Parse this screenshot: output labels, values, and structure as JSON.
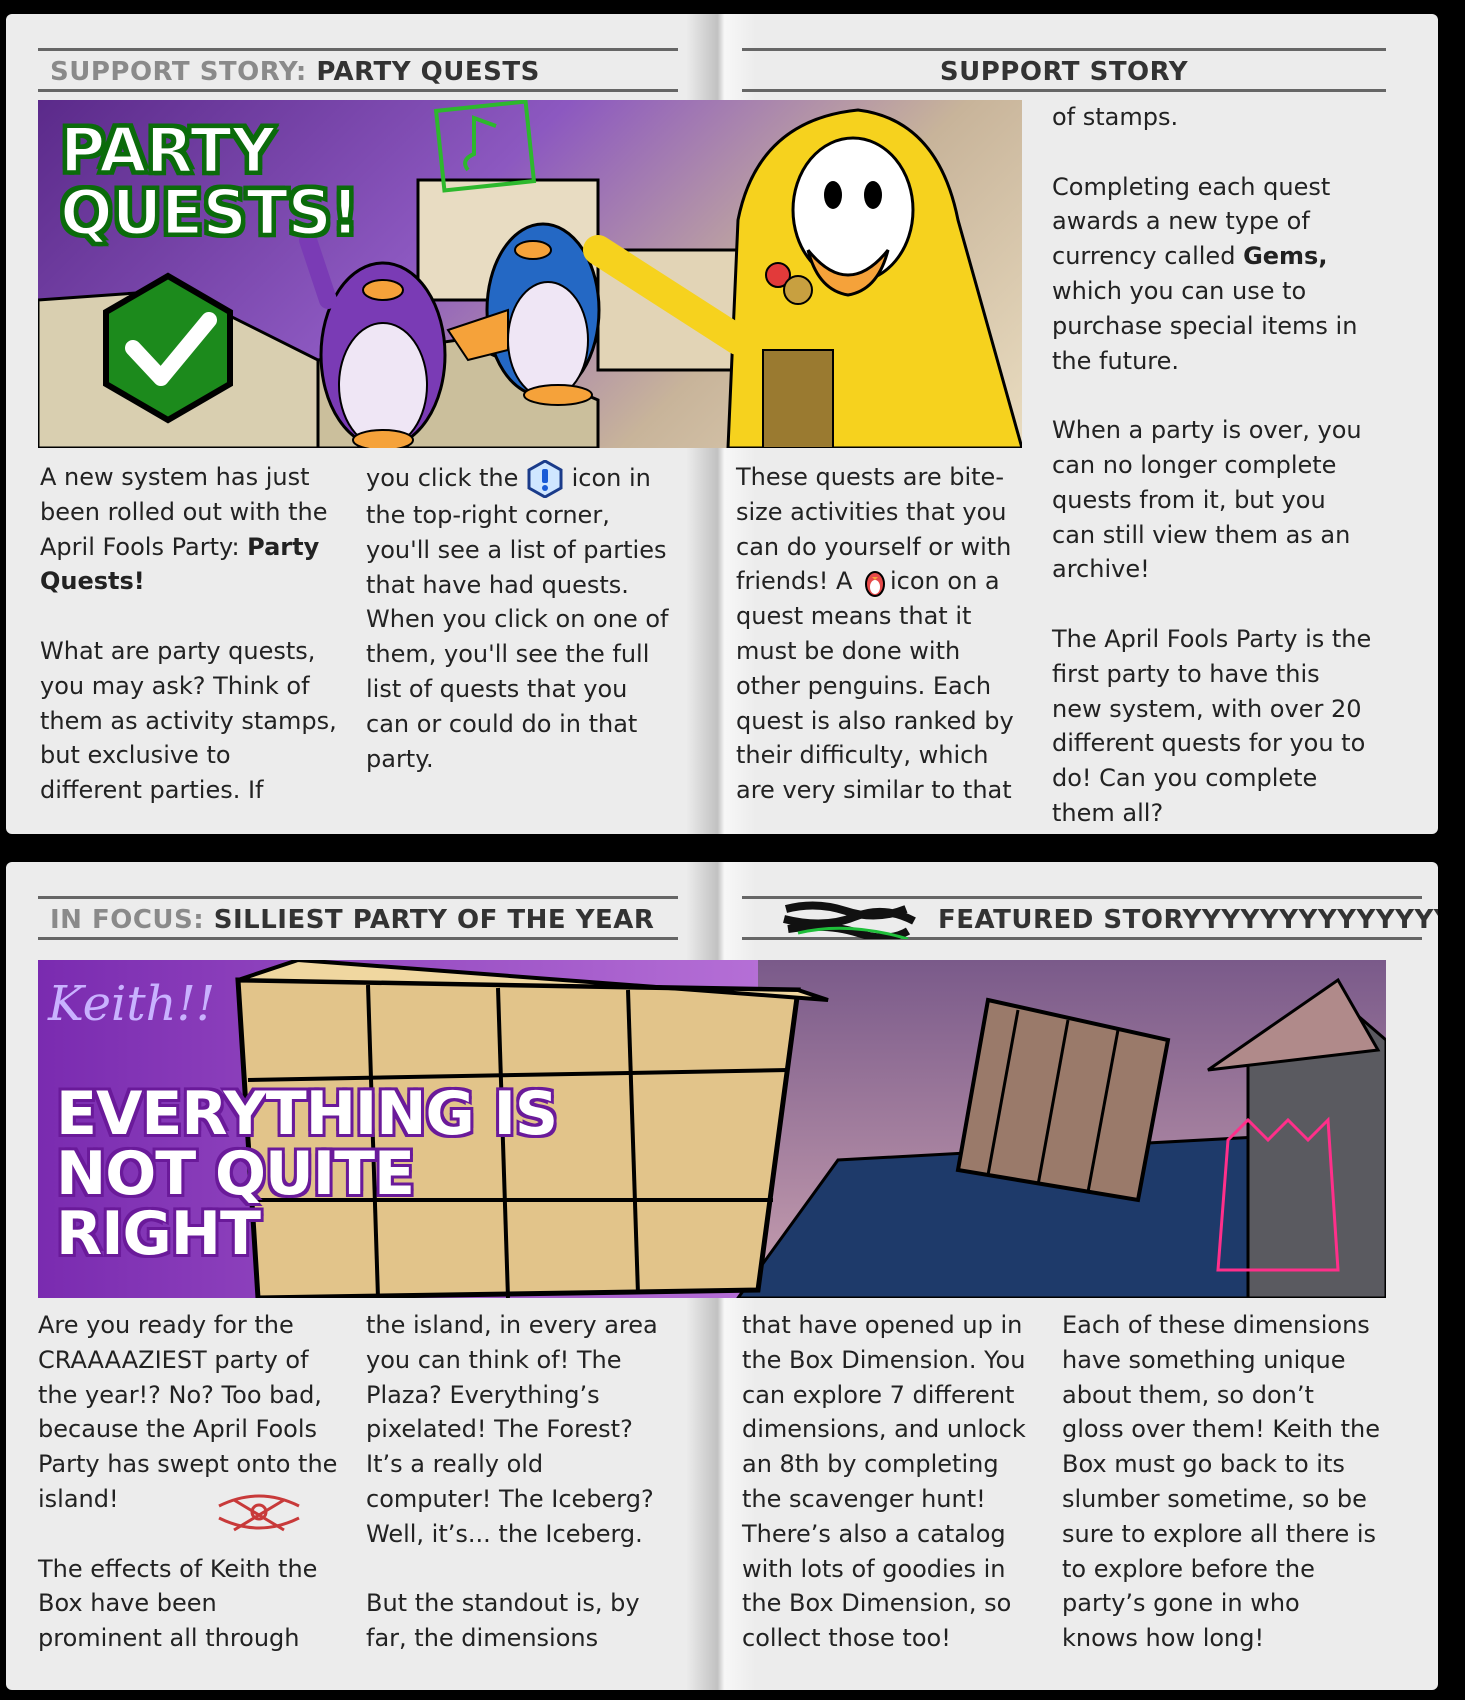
{
  "top_left_header": {
    "lead": "SUPPORT STORY:",
    "title": "PARTY QUESTS"
  },
  "top_right_header": {
    "title": "SUPPORT STORY"
  },
  "top_banner_title": "PARTY QUESTS!",
  "top_col1": {
    "p1_a": "A new system has just been rolled out with the April Fools Party: ",
    "p1_b": "Party Quests!",
    "p2": "What are party quests, you may ask? Think of them as activity stamps, but exclusive to different parties. If"
  },
  "top_col2": {
    "p1_a": "you click the ",
    "p1_b": " icon in the top-right corner, you'll see a list of parties that have had quests. When you click on one of them, you'll see the full list of quests that you can or could do in that party."
  },
  "top_col3": {
    "p1_a": "These quests are bite-size activities that you can do yourself or with friends! A ",
    "p1_b": "icon on a quest means that it must be done with other penguins. Each quest is also ranked by their difficulty, which are very similar to that"
  },
  "top_col4": {
    "p1": "of stamps.",
    "p2_a": "Completing each quest awards a new type of currency called ",
    "p2_b": "Gems,",
    "p2_c": " which you can use to purchase special items in the future.",
    "p3": "When a party is over, you can no longer complete quests from it, but you can still view them as an archive!",
    "p4": "The April Fools Party is the first party to have this new system, with over 20 different quests for you to do! Can you complete them all?"
  },
  "bot_left_header": {
    "lead": "IN FOCUS:",
    "title": "SILLIEST PARTY OF THE YEAR"
  },
  "bot_right_header": {
    "title": "FEATURED STORYYYYYYYYYYYYYY"
  },
  "bot_banner": {
    "scribble": "Keith!!",
    "line1": "EVERYTHING IS",
    "line2": "NOT QUITE",
    "line3": "RIGHT"
  },
  "bot_col1": {
    "p1": "Are you ready for the CRAAAAZIEST party of the year!? No? Too bad, because the April Fools Party has swept onto the island!",
    "p2": "The effects of Keith the Box have been prominent all through"
  },
  "bot_col2": {
    "p1": "the island, in every area you can think of! The Plaza? Everything’s pixelated! The Forest? It’s a really old computer! The Iceberg? Well, it’s... the Iceberg.",
    "p2": "But the standout is, by far, the dimensions"
  },
  "bot_col3": {
    "p1": "that have opened up in the Box Dimension. You can explore 7 different dimensions, and unlock an 8th by completing the scavenger hunt! There’s also a catalog with lots of goodies in the Box Dimension, so collect those too!"
  },
  "bot_col4": {
    "p1": "Each of these dimensions have something unique about them, so don’t gloss over them! Keith the Box must go back to its slumber sometime, so be sure to explore all there is to explore before the party’s gone in who knows how long!"
  }
}
